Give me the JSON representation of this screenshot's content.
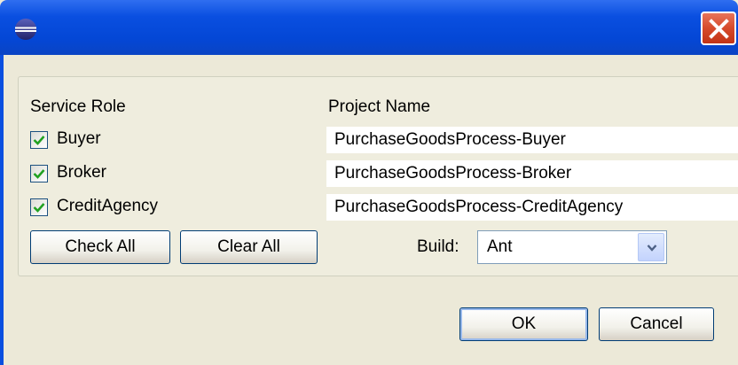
{
  "window": {
    "title": ""
  },
  "form": {
    "service_role_header": "Service Role",
    "project_name_header": "Project Name",
    "rows": [
      {
        "role": "Buyer",
        "checked": true,
        "project": "PurchaseGoodsProcess-Buyer"
      },
      {
        "role": "Broker",
        "checked": true,
        "project": "PurchaseGoodsProcess-Broker"
      },
      {
        "role": "CreditAgency",
        "checked": true,
        "project": "PurchaseGoodsProcess-CreditAgency"
      }
    ],
    "check_all_label": "Check All",
    "clear_all_label": "Clear All",
    "build_label": "Build:",
    "build_value": "Ant"
  },
  "buttons": {
    "ok_label": "OK",
    "cancel_label": "Cancel"
  },
  "colors": {
    "title_bar": "#0a4fe0",
    "close_button": "#d64a2b",
    "dialog_bg": "#ece9d8",
    "checkmark": "#21a121"
  },
  "icons": {
    "app": "eclipse-icon",
    "close": "close-icon",
    "dropdown": "chevron-down-icon",
    "check": "checkmark-icon"
  }
}
